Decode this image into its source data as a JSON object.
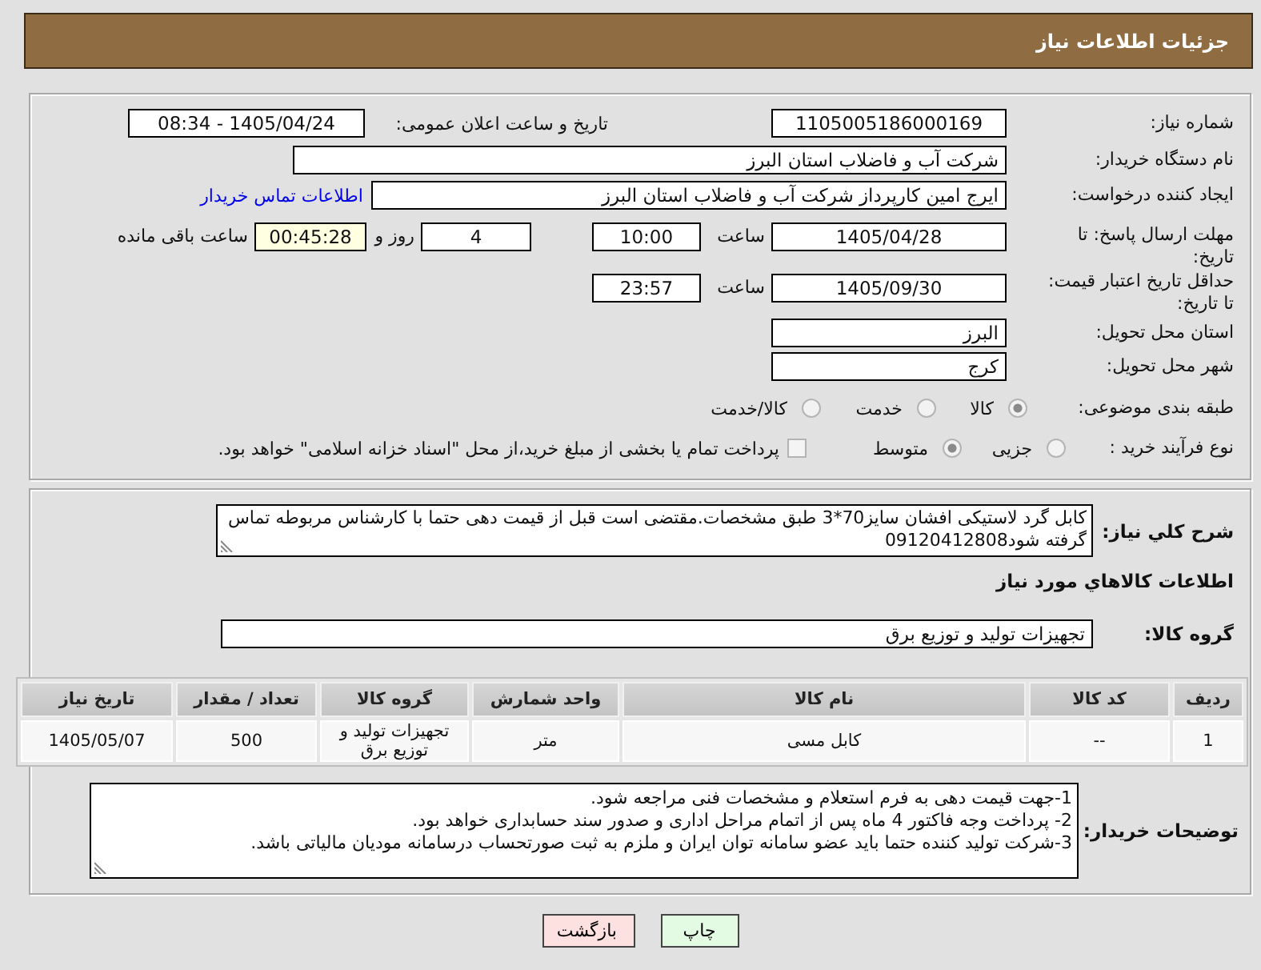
{
  "header": {
    "title": "جزئیات اطلاعات نیاز"
  },
  "need_info": {
    "need_number": {
      "label": "شماره نیاز:",
      "value": "1105005186000169"
    },
    "announce_datetime": {
      "label": "تاریخ و ساعت اعلان عمومی:",
      "value": "1405/04/24 - 08:34"
    },
    "buyer_org": {
      "label": "نام دستگاه خریدار:",
      "value": "شرکت آب و فاضلاب استان البرز"
    },
    "requester": {
      "label": "ایجاد کننده درخواست:",
      "value": "ایرج امین کارپرداز شرکت آب و فاضلاب استان البرز",
      "link": "اطلاعات تماس خریدار"
    },
    "reply_deadline": {
      "label": "مهلت ارسال پاسخ: تا تاریخ:",
      "date": "1405/04/28",
      "time_label": "ساعت",
      "time": "10:00",
      "days": "4",
      "days_label": "روز و",
      "remaining": "00:45:28",
      "remaining_label": "ساعت باقی مانده"
    },
    "price_validity": {
      "label": "حداقل تاریخ اعتبار قیمت: تا تاریخ:",
      "date": "1405/09/30",
      "time_label": "ساعت",
      "time": "23:57"
    },
    "delivery_province": {
      "label": "استان محل تحویل:",
      "value": "البرز"
    },
    "delivery_city": {
      "label": "شهر محل تحویل:",
      "value": "کرج"
    },
    "category": {
      "label": "طبقه بندی موضوعی:",
      "options": [
        {
          "label": "کالا",
          "selected": true
        },
        {
          "label": "خدمت",
          "selected": false
        },
        {
          "label": "کالا/خدمت",
          "selected": false
        }
      ]
    },
    "purchase_type": {
      "label": "نوع فرآیند خرید :",
      "options": [
        {
          "label": "جزیی",
          "selected": false
        },
        {
          "label": "متوسط",
          "selected": true
        }
      ],
      "treasury_payment": {
        "label": "پرداخت تمام یا بخشی از مبلغ خرید،از محل \"اسناد خزانه اسلامی\" خواهد بود.",
        "checked": false
      }
    }
  },
  "goods": {
    "description": {
      "label": "شرح کلي نياز:",
      "value": "کابل گرد لاستیکی افشان سایز70*3 طبق مشخصات.مقتضی است قبل از قیمت دهی حتما با کارشناس مربوطه تماس گرفته شود09120412808"
    },
    "heading": "اطلاعات کالاهاي مورد نياز",
    "goods_group": {
      "label": "گروه کالا:",
      "value": "تجهیزات تولید و توزیع برق"
    },
    "table": {
      "columns": [
        "ردیف",
        "کد کالا",
        "نام کالا",
        "واحد شمارش",
        "گروه کالا",
        "تعداد / مقدار",
        "تاریخ نیاز"
      ],
      "rows": [
        [
          "1",
          "--",
          "کابل مسی",
          "متر",
          "تجهیزات تولید و توزیع برق",
          "500",
          "1405/05/07"
        ]
      ]
    },
    "buyer_notes": {
      "label": "توضیحات خریدار:",
      "lines": [
        "1-جهت قیمت دهی به فرم استعلام و مشخصات فنی مراجعه شود.",
        "2- پرداخت وجه فاکتور 4 ماه پس از اتمام مراحل اداری و صدور سند حسابداری خواهد بود.",
        "3-شرکت تولید کننده حتما باید عضو سامانه توان ایران و ملزم به ثبت صورتحساب درسامانه مودیان مالیاتی باشد."
      ]
    }
  },
  "buttons": [
    {
      "label": "چاپ",
      "kind": "print"
    },
    {
      "label": "بازگشت",
      "kind": "back"
    }
  ]
}
